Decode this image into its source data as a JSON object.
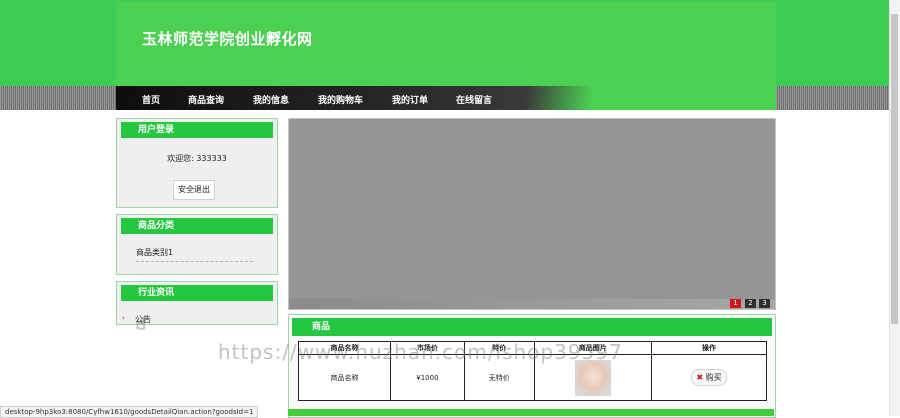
{
  "site": {
    "title": "玉林师范学院创业孵化网"
  },
  "nav": {
    "items": [
      "首页",
      "商品查询",
      "我的信息",
      "我的购物车",
      "我的订单",
      "在线留言"
    ]
  },
  "sidebar": {
    "login": {
      "title": "用户登录",
      "welcome": "欢迎您: 333333",
      "logout_label": "安全退出"
    },
    "categories": {
      "title": "商品分类",
      "items": [
        "商品类别1"
      ]
    },
    "news": {
      "title": "行业资讯",
      "items": [
        "公告"
      ]
    }
  },
  "slideshow": {
    "pages": [
      "1",
      "2",
      "3"
    ],
    "active_page": "1"
  },
  "products": {
    "title": "商品",
    "columns": [
      "商品名称",
      "市场价",
      "特价",
      "商品图片",
      "操作"
    ],
    "rows": [
      {
        "name": "商品名称",
        "market_price": "¥1000",
        "special_price": "无特价",
        "image": "baby-photo",
        "action_label": "购买"
      }
    ]
  },
  "status_bar": {
    "url": "desktop-9hp3ko3:8080/Cyfhw1610/goodsDetailQian.action?goodsId=1"
  },
  "watermark": "https://www.huzhan.com/ishop39597",
  "colors": {
    "brand_green": "#4bd052",
    "header_green": "#24c740",
    "accent_red": "#d11414"
  }
}
